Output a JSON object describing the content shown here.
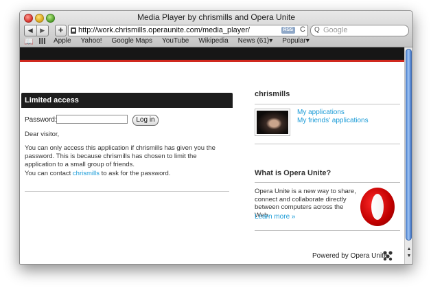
{
  "window": {
    "title": "Media Player by chrismills and Opera Unite"
  },
  "toolbar": {
    "back": "◀",
    "forward": "▶",
    "add": "+",
    "url": "http://work.chrismills.operaunite.com/media_player/",
    "rss": "RSS",
    "reload": "C",
    "search_placeholder": "Google",
    "search_icon": "Q"
  },
  "bookmarks": {
    "book_icon": "📖",
    "items": [
      "Apple",
      "Yahoo!",
      "Google Maps",
      "YouTube",
      "Wikipedia",
      "News (61)▾",
      "Popular▾"
    ]
  },
  "left": {
    "header": "Limited access",
    "password_label": "Password:",
    "password_value": "",
    "login_label": "Log in",
    "greeting": "Dear visitor,",
    "para1": "You can only access this application if chrismills has given you the password. This is because chrismills has chosen to limit the application to a small group of friends.",
    "para2_pre": "You can contact ",
    "para2_link": "chrismills",
    "para2_post": " to ask for the password."
  },
  "right": {
    "user_title": "chrismills",
    "links": [
      "My applications",
      "My friends' applications"
    ],
    "what_title": "What is Opera Unite?",
    "what_text": "Opera Unite is a new way to share, connect and collaborate directly between computers across the Web.",
    "learn_more": "Learn more »",
    "powered_pre": "Powered by ",
    "powered_brand": "Opera Unite"
  },
  "scrollbar": {
    "up": "▲",
    "down": "▼"
  },
  "colors": {
    "accent_red": "#d0291f",
    "link": "#1a9bd7",
    "header_bg": "#1d1d1d"
  }
}
